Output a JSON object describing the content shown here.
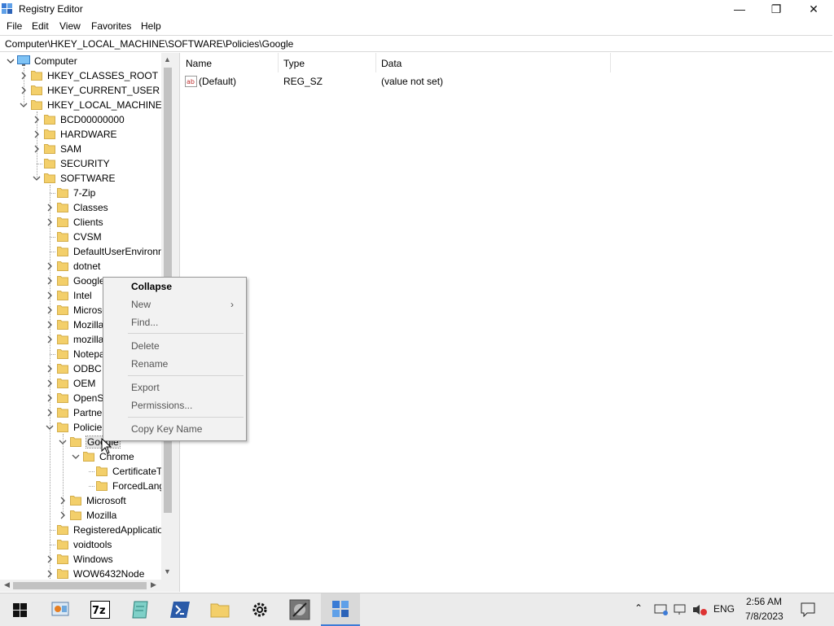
{
  "window": {
    "title": "Registry Editor",
    "minimize": "—",
    "maximize": "❐",
    "close": "✕"
  },
  "menu": [
    "File",
    "Edit",
    "View",
    "Favorites",
    "Help"
  ],
  "address": "Computer\\HKEY_LOCAL_MACHINE\\SOFTWARE\\Policies\\Google",
  "tree": {
    "computer": "Computer",
    "items": [
      "HKEY_CLASSES_ROOT",
      "HKEY_CURRENT_USER",
      "HKEY_LOCAL_MACHINE",
      "BCD00000000",
      "HARDWARE",
      "SAM",
      "SECURITY",
      "SOFTWARE",
      "7-Zip",
      "Classes",
      "Clients",
      "CVSM",
      "DefaultUserEnvironm",
      "dotnet",
      "Google",
      "Intel",
      "Microsoft",
      "Mozilla",
      "mozilla.org",
      "Notepad++",
      "ODBC",
      "OEM",
      "OpenSSH",
      "Partner",
      "Policies",
      "Google",
      "Chrome",
      "CertificateT",
      "ForcedLang",
      "Microsoft",
      "Mozilla",
      "RegisteredApplicatio",
      "voidtools",
      "Windows",
      "WOW6432Node"
    ]
  },
  "columns": {
    "name": "Name",
    "type": "Type",
    "data": "Data"
  },
  "values": [
    {
      "name": "(Default)",
      "type": "REG_SZ",
      "data": "(value not set)"
    }
  ],
  "context_menu": {
    "collapse": "Collapse",
    "new": "New",
    "find": "Find...",
    "delete": "Delete",
    "rename": "Rename",
    "export": "Export",
    "permissions": "Permissions...",
    "copy_key_name": "Copy Key Name"
  },
  "taskbar": {
    "language": "ENG",
    "time": "2:56 AM",
    "date": "7/8/2023"
  },
  "colors": {
    "accent": "#3d7bd6",
    "folder": "#f3cf6a",
    "selection": "#e5e5e5"
  }
}
